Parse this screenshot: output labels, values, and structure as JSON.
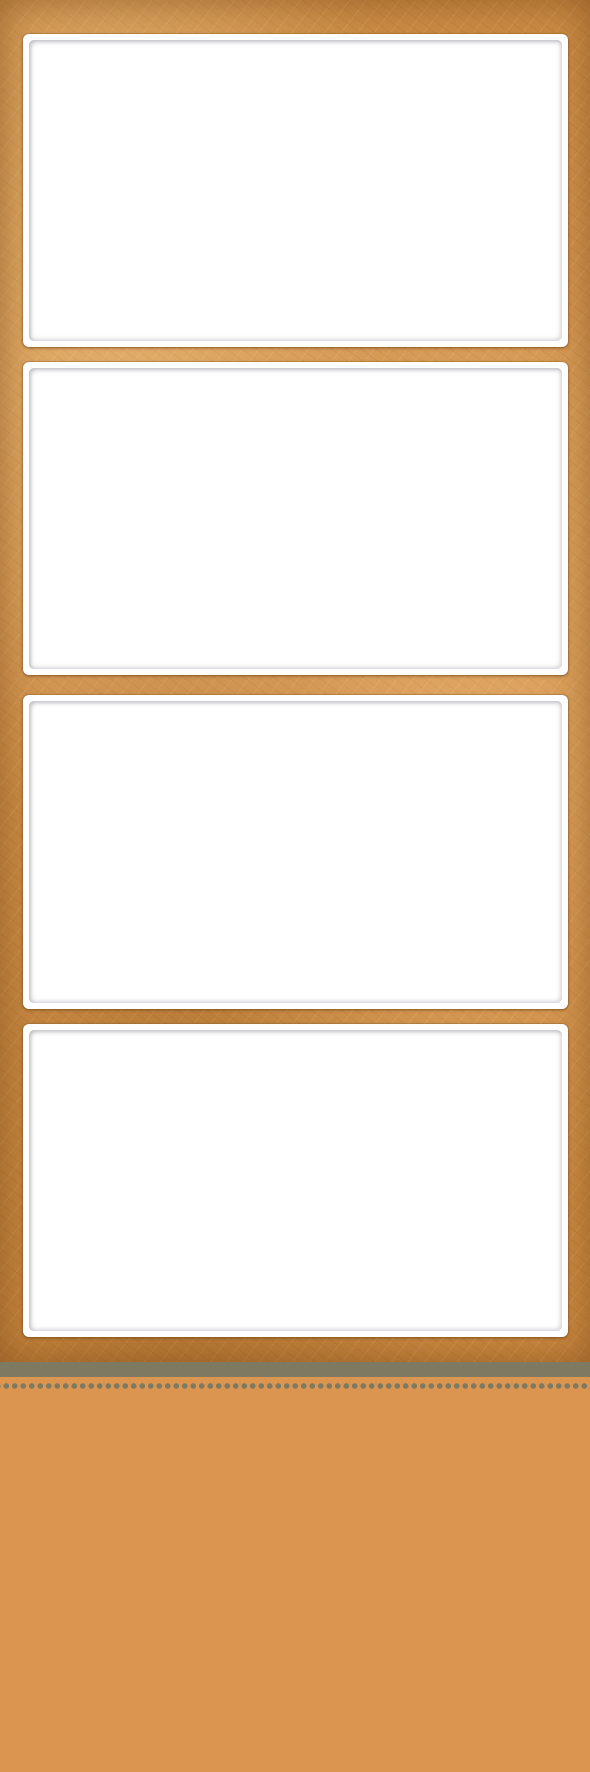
{
  "layout": {
    "background_color": "#c98a43",
    "frame_color": "#ffffff",
    "band_color": "#7e7a62",
    "footer_color": "#dc9550"
  },
  "frames": [
    {
      "id": "frame-1",
      "content": ""
    },
    {
      "id": "frame-2",
      "content": ""
    },
    {
      "id": "frame-3",
      "content": ""
    },
    {
      "id": "frame-4",
      "content": ""
    }
  ]
}
